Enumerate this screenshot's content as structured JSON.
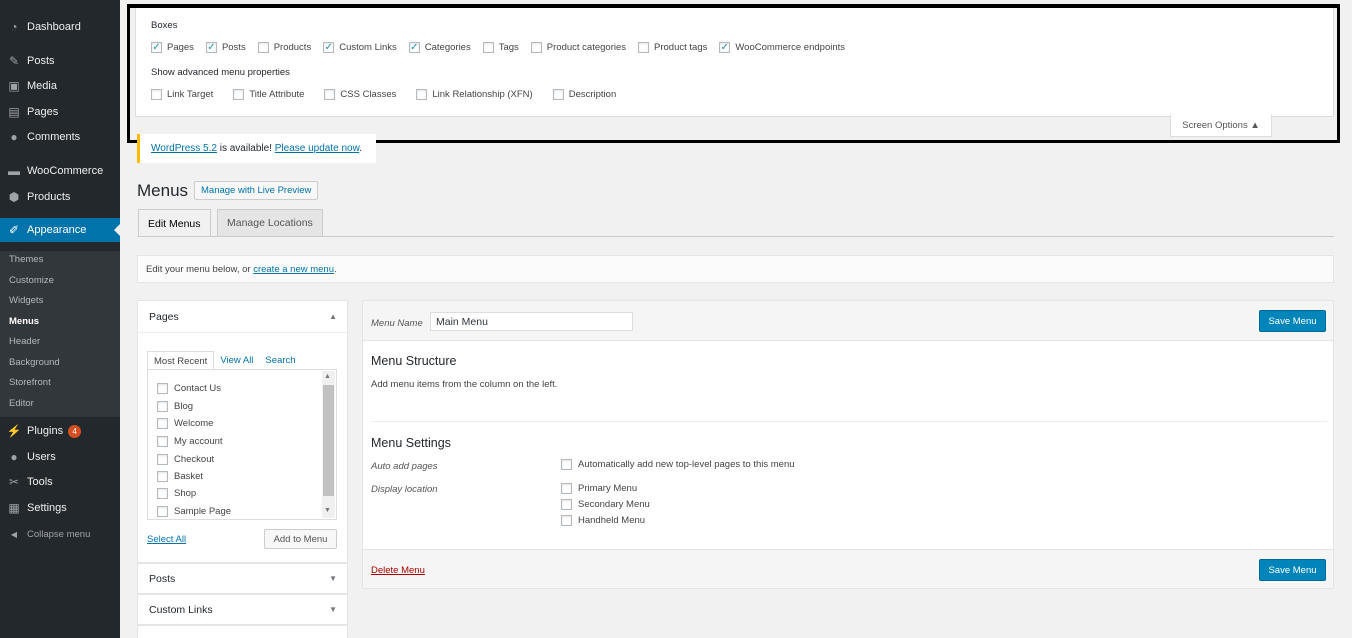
{
  "sidebar": {
    "items": [
      {
        "label": "Dashboard",
        "icon": "dashboard-icon",
        "glyph": "◔"
      },
      {
        "label": "Posts",
        "icon": "pin-icon",
        "glyph": "✎"
      },
      {
        "label": "Media",
        "icon": "media-icon",
        "glyph": "▣"
      },
      {
        "label": "Pages",
        "icon": "page-icon",
        "glyph": "▤"
      },
      {
        "label": "Comments",
        "icon": "comment-icon",
        "glyph": "●"
      },
      {
        "label": "WooCommerce",
        "icon": "woocommerce-icon",
        "glyph": "▬"
      },
      {
        "label": "Products",
        "icon": "products-icon",
        "glyph": "⬢"
      },
      {
        "label": "Appearance",
        "icon": "brush-icon",
        "glyph": "✐"
      },
      {
        "label": "Plugins",
        "icon": "plugin-icon",
        "glyph": "⚡",
        "badge": "4"
      },
      {
        "label": "Users",
        "icon": "user-icon",
        "glyph": "●"
      },
      {
        "label": "Tools",
        "icon": "wrench-icon",
        "glyph": "✂"
      },
      {
        "label": "Settings",
        "icon": "settings-icon",
        "glyph": "▦"
      },
      {
        "label": "Collapse menu",
        "icon": "collapse-icon",
        "glyph": "◀"
      }
    ],
    "submenu": [
      "Themes",
      "Customize",
      "Widgets",
      "Menus",
      "Header",
      "Background",
      "Storefront",
      "Editor"
    ],
    "accent": "#0073aa"
  },
  "screen_options": {
    "boxes_heading": "Boxes",
    "boxes": [
      {
        "label": "Pages",
        "checked": true
      },
      {
        "label": "Posts",
        "checked": true
      },
      {
        "label": "Products",
        "checked": false
      },
      {
        "label": "Custom Links",
        "checked": true
      },
      {
        "label": "Categories",
        "checked": true
      },
      {
        "label": "Tags",
        "checked": false
      },
      {
        "label": "Product categories",
        "checked": false
      },
      {
        "label": "Product tags",
        "checked": false
      },
      {
        "label": "WooCommerce endpoints",
        "checked": true
      }
    ],
    "advanced_heading": "Show advanced menu properties",
    "advanced": [
      {
        "label": "Link Target",
        "checked": false
      },
      {
        "label": "Title Attribute",
        "checked": false
      },
      {
        "label": "CSS Classes",
        "checked": false
      },
      {
        "label": "Link Relationship (XFN)",
        "checked": false
      },
      {
        "label": "Description",
        "checked": false
      }
    ],
    "tab_label": "Screen Options ▲"
  },
  "update_nag": {
    "link_version": "WordPress 5.2",
    "middle": " is available! ",
    "link_update": "Please update now",
    "end": "."
  },
  "page": {
    "title": "Menus",
    "live_preview": "Manage with Live Preview",
    "tabs": [
      "Edit Menus",
      "Manage Locations"
    ],
    "notice_prefix": "Edit your menu below, or ",
    "notice_link": "create a new menu",
    "notice_suffix": "."
  },
  "left": {
    "pages_title": "Pages",
    "pages_tabs": [
      "Most Recent",
      "View All",
      "Search"
    ],
    "pages": [
      "Contact Us",
      "Blog",
      "Welcome",
      "My account",
      "Checkout",
      "Basket",
      "Shop",
      "Sample Page"
    ],
    "select_all": "Select All",
    "add_to_menu": "Add to Menu",
    "posts_title": "Posts",
    "custom_links_title": "Custom Links",
    "arrow_up": "▲",
    "arrow_down": "▼"
  },
  "editor": {
    "menu_name_label": "Menu Name",
    "menu_name_value": "Main Menu",
    "save_label": "Save Menu",
    "structure_title": "Menu Structure",
    "structure_hint": "Add menu items from the column on the left.",
    "settings_title": "Menu Settings",
    "auto_add_label": "Auto add pages",
    "auto_add_option": "Automatically add new top-level pages to this menu",
    "display_location_label": "Display location",
    "locations": [
      "Primary Menu",
      "Secondary Menu",
      "Handheld Menu"
    ],
    "delete_label": "Delete Menu"
  }
}
